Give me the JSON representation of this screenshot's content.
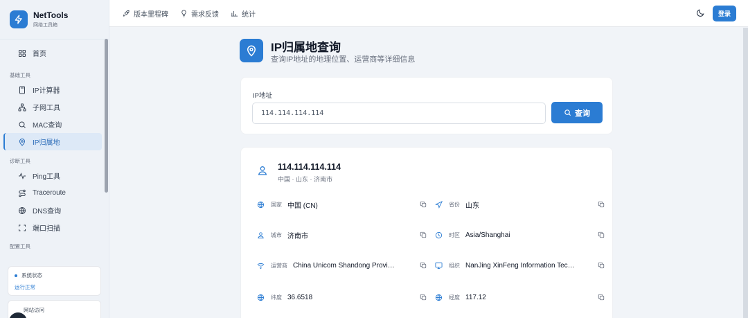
{
  "brand": {
    "name": "NetTools",
    "subtitle": "网络工具箱"
  },
  "sidebar": {
    "home": "首页",
    "section_basic": "基础工具",
    "ip_calc": "IP计算器",
    "subnet": "子网工具",
    "mac": "MAC查询",
    "ip_geo": "IP归属地",
    "section_diag": "诊断工具",
    "ping": "Ping工具",
    "traceroute": "Traceroute",
    "dns": "DNS查询",
    "port_scan": "端口扫描",
    "section_config": "配置工具",
    "status_label": "系统状态",
    "status_value": "运行正常",
    "visit_label": "网站访问"
  },
  "topbar": {
    "link_milestone": "版本里程碑",
    "link_feedback": "需求反馈",
    "link_stats": "统计",
    "login": "登录"
  },
  "page": {
    "title": "IP归属地查询",
    "subtitle": "查询IP地址的地理位置、运营商等详细信息"
  },
  "search": {
    "label": "IP地址",
    "value": "114.114.114.114",
    "button": "查询"
  },
  "result": {
    "ip": "114.114.114.114",
    "location": "中国 · 山东 · 济南市",
    "fields": {
      "country": {
        "label": "国家",
        "value": "中国 (CN)"
      },
      "province": {
        "label": "省份",
        "value": "山东"
      },
      "city": {
        "label": "城市",
        "value": "济南市"
      },
      "timezone": {
        "label": "时区",
        "value": "Asia/Shanghai"
      },
      "isp": {
        "label": "运营商",
        "value": "China Unicom Shandong Province Network"
      },
      "org": {
        "label": "组织",
        "value": "NanJing XinFeng Information Technologies"
      },
      "lat": {
        "label": "纬度",
        "value": "36.6518"
      },
      "lon": {
        "label": "经度",
        "value": "117.12"
      }
    }
  },
  "colors": {
    "accent": "#2b7cd3",
    "background": "#f1f4f8",
    "card": "#ffffff"
  }
}
